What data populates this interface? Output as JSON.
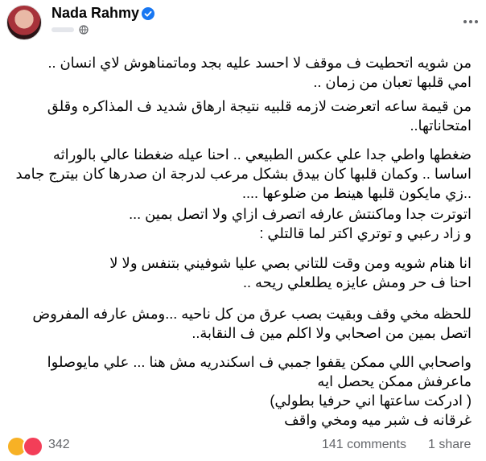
{
  "header": {
    "author_name": "Nada Rahmy",
    "verified_icon": "verified-badge-icon",
    "globe_icon": "globe-icon",
    "more_icon": "more-horizontal-icon"
  },
  "post": {
    "paragraphs": [
      [
        "من شويه اتحطيت ف موقف لا احسد عليه بجد وماتمناهوش لاي انسان ..",
        "امي قلبها تعبان من زمان .."
      ],
      [
        "من قيمة ساعه اتعرضت لازمه قلبيه  نتيجة ارهاق شديد ف المذاكره وقلق",
        "امتحاناتها.."
      ],
      [
        "ضغطها واطي جدا علي عكس الطبيعي .. احنا عيله ضغطنا عالي بالوراثه",
        "اساسا .. وكمان قلبها كان بيدق بشكل مرعب لدرجة ان صدرها كان بيترج جامد",
        "..زي مايكون قلبها هينط من ضلوعها ...."
      ],
      [
        "اتوترت جدا وماكنتش عارفه اتصرف ازاي ولا اتصل بمين ...",
        "و زاد رعبي و توتري اكتر لما قالتلي :"
      ],
      [
        "انا هنام شويه ومن وقت للتاني بصي عليا شوفيني بتنفس ولا لا",
        "احنا ف حر ومش عايزه يطلعلي ريحه .."
      ],
      [
        "للحظه مخي وقف وبقيت بصب عرق من كل ناحيه ...ومش عارفه المفروض",
        "اتصل بمين من اصحابي ولا اكلم مين ف النقابة.."
      ],
      [
        "واصحابي اللي ممكن يقفوا جمبي ف اسكندريه مش هنا ... علي مايوصلوا",
        "ماعرفش ممكن يحصل ايه",
        "( ادركت ساعتها اني حرفيا بطولي)",
        "غرقانه ف شبر ميه ومخي واقف"
      ]
    ]
  },
  "footer": {
    "reactions_icon": "like-care-reaction-icon",
    "reaction_count": "342",
    "comments": "141 comments",
    "shares": "1 share"
  },
  "colors": {
    "text": "#050505",
    "secondary": "#65676b",
    "verified": "#1877f2",
    "background": "#ffffff"
  }
}
